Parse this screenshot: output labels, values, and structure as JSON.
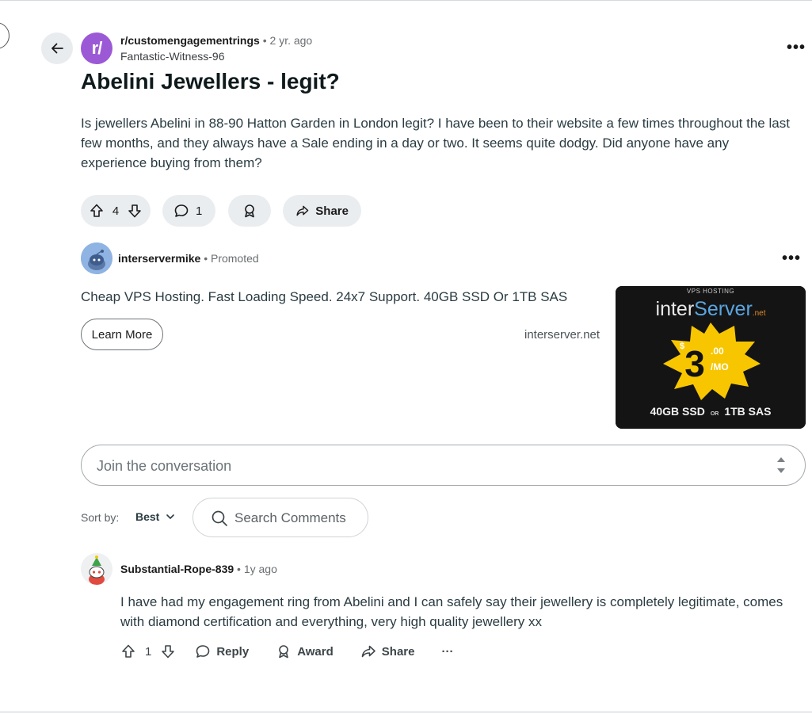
{
  "post": {
    "subreddit": "r/customengagementrings",
    "subreddit_initial": "r/",
    "age": "2 yr. ago",
    "author": "Fantastic-Witness-96",
    "title": "Abelini Jewellers - legit?",
    "body": "Is jewellers Abelini in 88-90 Hatton Garden in London legit? I have been to their website a few times throughout the last few months, and they always have a Sale ending in a day or two. It seems quite dodgy. Did anyone have any experience buying from them?",
    "upvotes": "4",
    "comments": "1",
    "share_label": "Share"
  },
  "promo": {
    "user": "interservermike",
    "badge": "Promoted",
    "text": "Cheap VPS Hosting. Fast Loading Speed. 24x7 Support. 40GB SSD Or 1TB SAS",
    "button": "Learn More",
    "domain": "interserver.net",
    "image": {
      "top": "VPS HOSTING",
      "brand_left": "inter",
      "brand_right": "Server",
      "brand_suffix": ".net",
      "currency": "$",
      "price": "3",
      "cents": ".00",
      "per": "/MO",
      "left_spec": "40GB SSD",
      "or": "OR",
      "right_spec": "1TB SAS"
    }
  },
  "composer": {
    "placeholder": "Join the conversation"
  },
  "sort": {
    "label": "Sort by:",
    "value": "Best"
  },
  "search": {
    "placeholder": "Search Comments"
  },
  "comment": {
    "user": "Substantial-Rope-839",
    "age": "1y ago",
    "text": "I have had my engagement ring from Abelini and I can safely say their jewellery is completely legitimate, comes with diamond certification and everything, very high quality jewellery xx",
    "votes": "1",
    "reply": "Reply",
    "award": "Award",
    "share": "Share",
    "more": "···"
  },
  "ui": {
    "dot": "•",
    "more": "•••"
  },
  "colors": {
    "subreddit_avatar": "#9b59d6",
    "pill_bg": "#eaedef",
    "ad_badge": "#f7c600"
  }
}
